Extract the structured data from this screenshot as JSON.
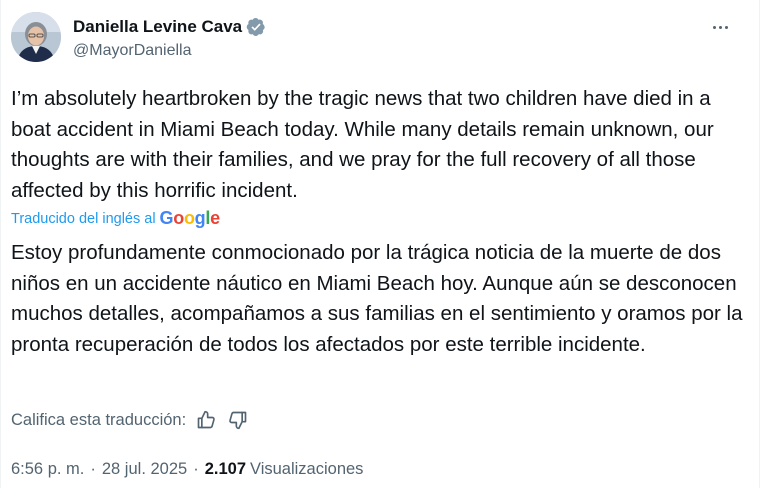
{
  "author": {
    "display_name": "Daniella Levine Cava",
    "handle": "@MayorDaniella"
  },
  "tweet": {
    "original_text": "I’m absolutely heartbroken by the tragic news that two children have died in a boat accident in Miami Beach today. While many details remain unknown, our thoughts are with their families, and we pray for the full recovery of all those affected by this horrific incident.",
    "translated_by_label": "Traducido del inglés al",
    "translator_logo": {
      "g1": "G",
      "o1": "o",
      "o2": "o",
      "g2": "g",
      "l": "l",
      "e": "e"
    },
    "translated_text": "Estoy profundamente conmocionado por la trágica noticia de la muerte de dos niños en un accidente náutico en Miami Beach hoy. Aunque aún se desconocen muchos detalles, acompañamos a sus familias en el sentimiento y oramos por la pronta recuperación de todos los afectados por este terrible incidente.",
    "rate_translation_label": "Califica esta traducción:"
  },
  "meta": {
    "time": "6:56 p. m.",
    "separator": "·",
    "date": "28 jul. 2025",
    "views_count": "2.107",
    "views_label": "Visualizaciones"
  },
  "colors": {
    "text": "#0f1419",
    "secondary": "#536471",
    "link": "#1d9bf0",
    "verified_badge": "#829aab"
  },
  "icons": {
    "verified": "verified-badge-icon",
    "more": "more-options-icon",
    "thumbs_up": "thumbs-up-icon",
    "thumbs_down": "thumbs-down-icon"
  }
}
